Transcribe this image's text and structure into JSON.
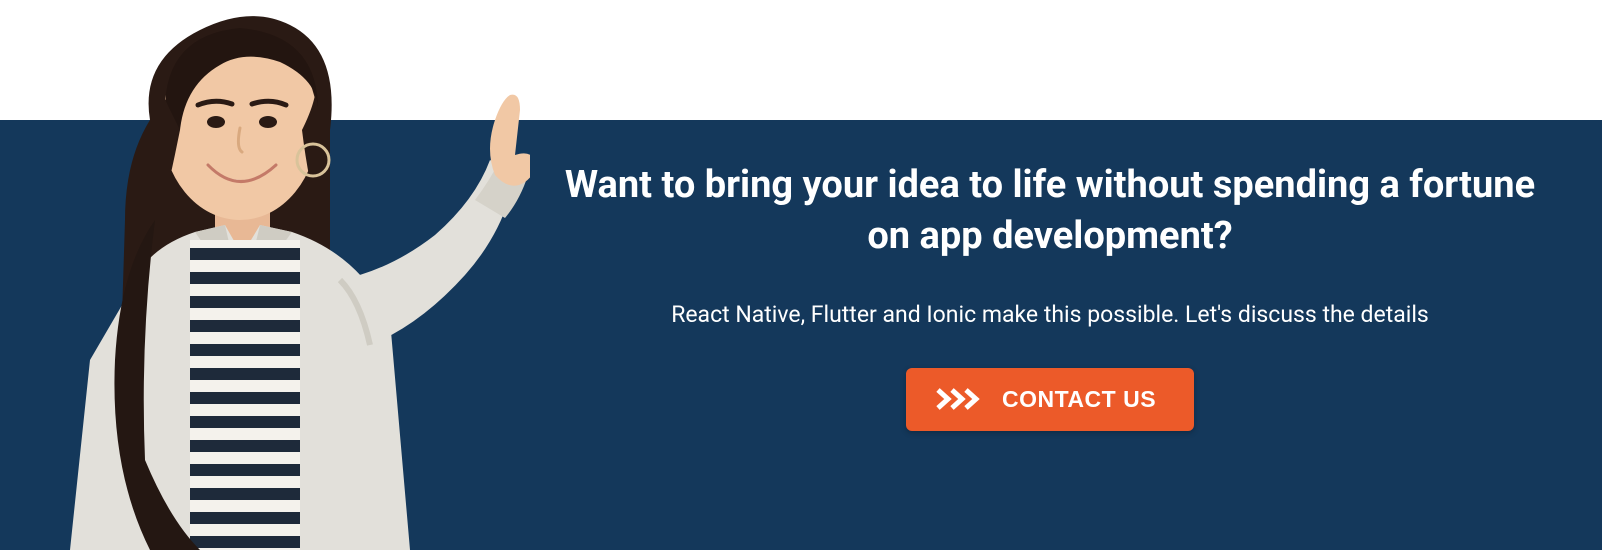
{
  "banner": {
    "headline": "Want to bring your idea to life without spending a fortune on app development?",
    "subhead": "React Native, Flutter and Ionic make this possible. Let's discuss the details",
    "cta_label": "CONTACT US"
  },
  "colors": {
    "banner_bg": "#14385b",
    "cta_bg": "#ec5a29",
    "text": "#ffffff"
  },
  "image": {
    "description": "woman-pointing",
    "alt": "Smiling woman in grey blazer and striped top pointing up"
  }
}
